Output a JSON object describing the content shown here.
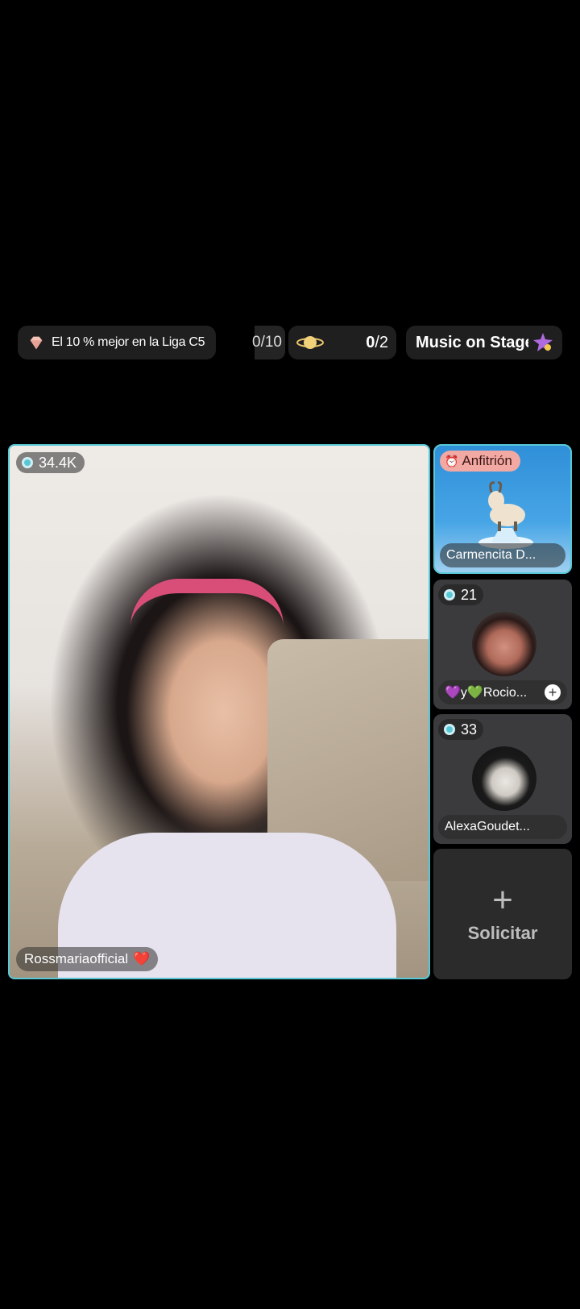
{
  "top_bar": {
    "league_text": "El 10 % mejor en la Liga C5",
    "progress_text": "0/10",
    "planet_count": "0",
    "planet_total": "/2",
    "music_text": "Music on Stage"
  },
  "main_stream": {
    "viewer_count": "34.4K",
    "streamer_name": "Rossmariaofficial",
    "heart": "❤️"
  },
  "host_tile": {
    "badge": "Anfitrión",
    "name": "Carmencita D..."
  },
  "guest1": {
    "viewer_count": "21",
    "name": "💜y💚Rocio...",
    "add": "+"
  },
  "guest2": {
    "viewer_count": "33",
    "name": "AlexaGoudet..."
  },
  "request": {
    "plus": "+",
    "label": "Solicitar"
  },
  "colors": {
    "accent": "#58c7d6",
    "host_badge": "#f2a9a4"
  }
}
